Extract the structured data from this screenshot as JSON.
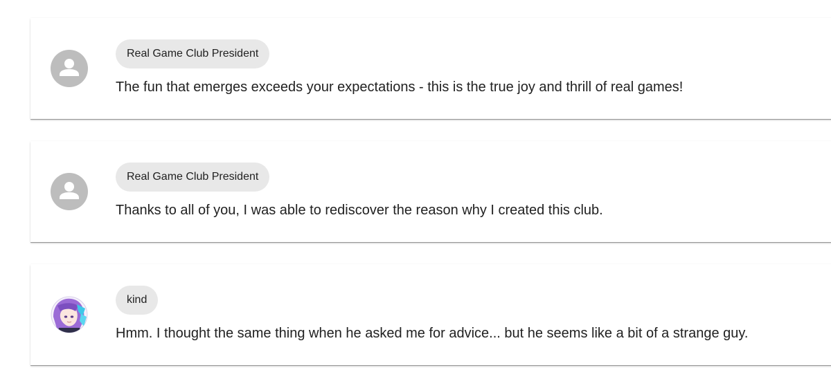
{
  "messages": [
    {
      "sender": "Real Game Club President",
      "avatar_icon": "person-icon",
      "text": "The fun that emerges exceeds your expectations - this is the true joy and thrill of real games!"
    },
    {
      "sender": "Real Game Club President",
      "avatar_icon": "person-icon",
      "text": "Thanks to all of you, I was able to rediscover the reason why I created this club."
    },
    {
      "sender": "kind",
      "avatar_icon": "character-portrait",
      "text": "Hmm. I thought the same thing when he asked me for advice... but he seems like a bit of a strange guy."
    }
  ],
  "colors": {
    "avatar_default_bg": "#bdbdbd",
    "chip_bg": "#e8e8e8",
    "text": "#212121",
    "anime_hair": "#9b6bd6",
    "anime_accent": "#3ec7e8"
  }
}
